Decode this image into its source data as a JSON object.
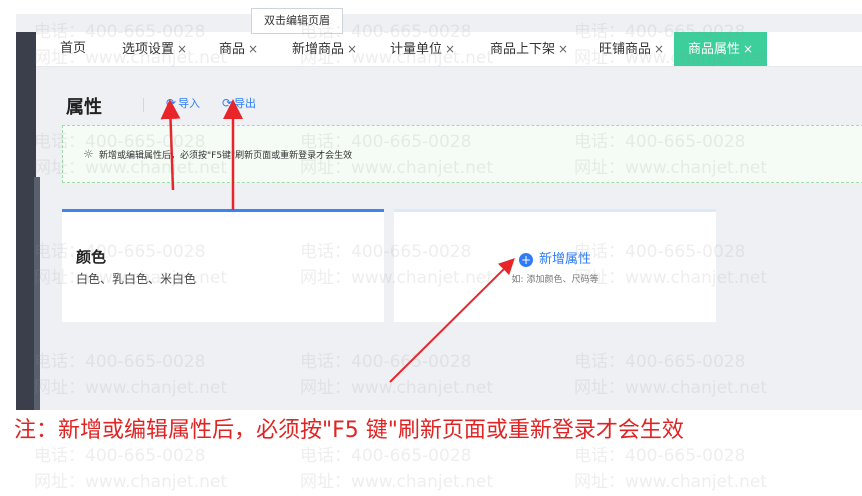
{
  "tooltip": "双击编辑页眉",
  "tabs": [
    {
      "label": "首页",
      "close": ""
    },
    {
      "label": "选项设置",
      "close": "×"
    },
    {
      "label": "商品",
      "close": "×"
    },
    {
      "label": "新增商品",
      "close": "×"
    },
    {
      "label": "计量单位",
      "close": "×"
    },
    {
      "label": "商品上下架",
      "close": "×"
    },
    {
      "label": "旺铺商品",
      "close": "×"
    },
    {
      "label": "商品属性",
      "close": "×"
    }
  ],
  "page": {
    "title": "属性",
    "import_label": "导入",
    "export_label": "导出",
    "notice": "新增或编辑属性后，必须按\"F5键\"刷新页面或重新登录才会生效"
  },
  "attribute_card": {
    "name": "颜色",
    "values": "白色、乳白色、米白色"
  },
  "add_card": {
    "label": "新增属性",
    "plus": "+",
    "hint": "如: 添加颜色、尺码等"
  },
  "footer_note": "注：新增或编辑属性后，必须按\"F5 键\"刷新页面或重新登录才会生效",
  "watermark": {
    "phone": "电话：400-665-0028",
    "site": "网址：www.chanjet.net"
  },
  "colors": {
    "accent": "#3ccf9b",
    "link": "#2f7cf6",
    "arrow": "#e8262a",
    "note": "#e02424"
  }
}
